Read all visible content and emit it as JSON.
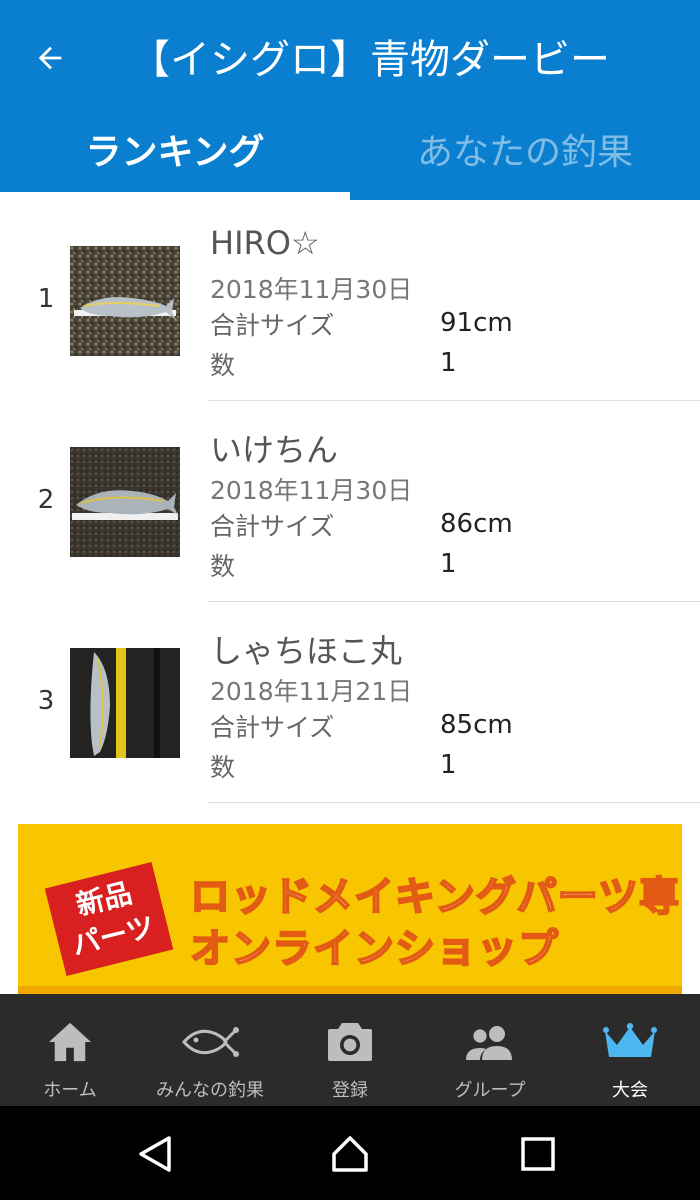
{
  "header": {
    "title": "【イシグロ】青物ダービー",
    "back_icon": "arrow-left-icon"
  },
  "tabs": [
    {
      "label": "ランキング",
      "active": true
    },
    {
      "label": "あなたの釣果",
      "active": false
    }
  ],
  "field_labels": {
    "size": "合計サイズ",
    "count": "数"
  },
  "rankings": [
    {
      "rank": "1",
      "name": "HIRO☆",
      "date": "2018年11月30日",
      "size": "91cm",
      "count": "1"
    },
    {
      "rank": "2",
      "name": "いけちん",
      "date": "2018年11月30日",
      "size": "86cm",
      "count": "1"
    },
    {
      "rank": "3",
      "name": "しゃちほこ丸",
      "date": "2018年11月21日",
      "size": "85cm",
      "count": "1"
    }
  ],
  "ad": {
    "badge_line1": "新品",
    "badge_line2": "パーツ",
    "line1": "ロッドメイキングパーツ専門",
    "line2": "オンラインショップ"
  },
  "bottom_nav": [
    {
      "label": "ホーム",
      "icon": "home-icon",
      "active": false
    },
    {
      "label": "みんなの釣果",
      "icon": "fish-icon",
      "active": false
    },
    {
      "label": "登録",
      "icon": "camera-icon",
      "active": false
    },
    {
      "label": "グループ",
      "icon": "group-icon",
      "active": false
    },
    {
      "label": "大会",
      "icon": "crown-icon",
      "active": true
    }
  ],
  "colors": {
    "primary": "#0a7fd0",
    "active_nav": "#4db8f0",
    "nav_bg": "#2b2b2b",
    "ad_bg": "#f7c600"
  }
}
